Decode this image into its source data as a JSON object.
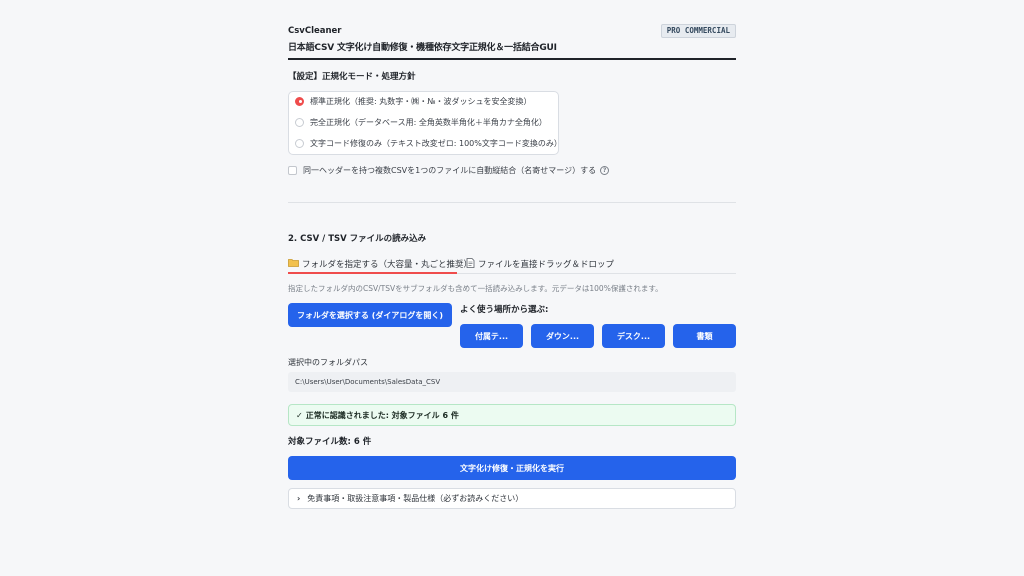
{
  "header": {
    "app_name": "CsvCleaner",
    "subtitle": "日本語CSV 文字化け自動修復・機種依存文字正規化＆一括結合GUI",
    "badge": "PRO COMMERCIAL"
  },
  "settings": {
    "title": "【設定】正規化モード・処理方針",
    "options": [
      {
        "label": "標準正規化（推奨: 丸数字・㈱・№・波ダッシュを安全変換）",
        "selected": true
      },
      {
        "label": "完全正規化（データベース用: 全角英数半角化＋半角カナ全角化）",
        "selected": false
      },
      {
        "label": "文字コード修復のみ（テキスト改変ゼロ: 100%文字コード変換のみ）",
        "selected": false
      }
    ],
    "merge_label": "同一ヘッダーを持つ複数CSVを1つのファイルに自動縦結合（名寄せマージ）する",
    "merge_checked": false,
    "help_icon": "?"
  },
  "load": {
    "title": "2. CSV / TSV ファイルの読み込み",
    "tabs": [
      {
        "label": "フォルダを指定する（大容量・丸ごと推奨）",
        "icon": "folder-icon",
        "active": true
      },
      {
        "label": "ファイルを直接ドラッグ＆ドロップ",
        "icon": "document-icon",
        "active": false
      }
    ],
    "caption": "指定したフォルダ内のCSV/TSVをサブフォルダも含めて一括読み込みします。元データは100%保護されます。",
    "select_folder_button": "フォルダを選択する (ダイアログを開く)",
    "frequent_label": "よく使う場所から選ぶ:",
    "places": [
      "付属テ...",
      "ダウン...",
      "デスク...",
      "書類"
    ],
    "path_label": "選択中のフォルダパス",
    "path_value": "C:\\Users\\User\\Documents\\SalesData_CSV",
    "success_message": "正常に認識されました: 対象ファイル 6 件",
    "count_label": "対象ファイル数: 6 件",
    "run_button": "文字化け修復・正規化を実行",
    "expander_label": "免責事項・取扱注意事項・製品仕様（必ずお読みください）"
  },
  "colors": {
    "accent": "#2563eb",
    "radio_selected": "#ef4c4c",
    "success_bg": "#ecfbf1"
  }
}
